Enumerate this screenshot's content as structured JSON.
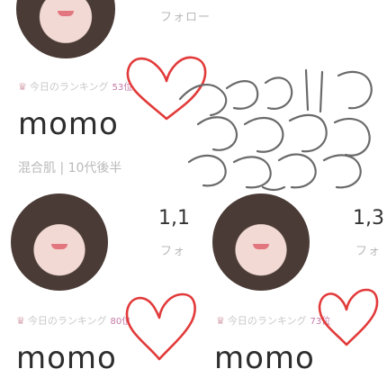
{
  "top": {
    "follow_label": "フォロー"
  },
  "cards": [
    {
      "rank_label": "今日のランキング",
      "rank_value": "53位",
      "name": "momo",
      "meta": "混合肌 | 10代後半"
    },
    {
      "follow_count": "1,1",
      "follow_label": "フォ"
    },
    {
      "follow_count": "1,3",
      "follow_label": "フォ"
    },
    {
      "rank_label": "今日のランキング",
      "rank_value": "80位",
      "name": "momo"
    },
    {
      "rank_label": "今日のランキング",
      "rank_value": "73位",
      "name": "momo"
    }
  ],
  "icons": {
    "crown": "crown-icon",
    "heart": "heart-annotation-icon"
  },
  "colors": {
    "accent_red": "#e23a3a",
    "rank_pink": "#c47aa7"
  }
}
